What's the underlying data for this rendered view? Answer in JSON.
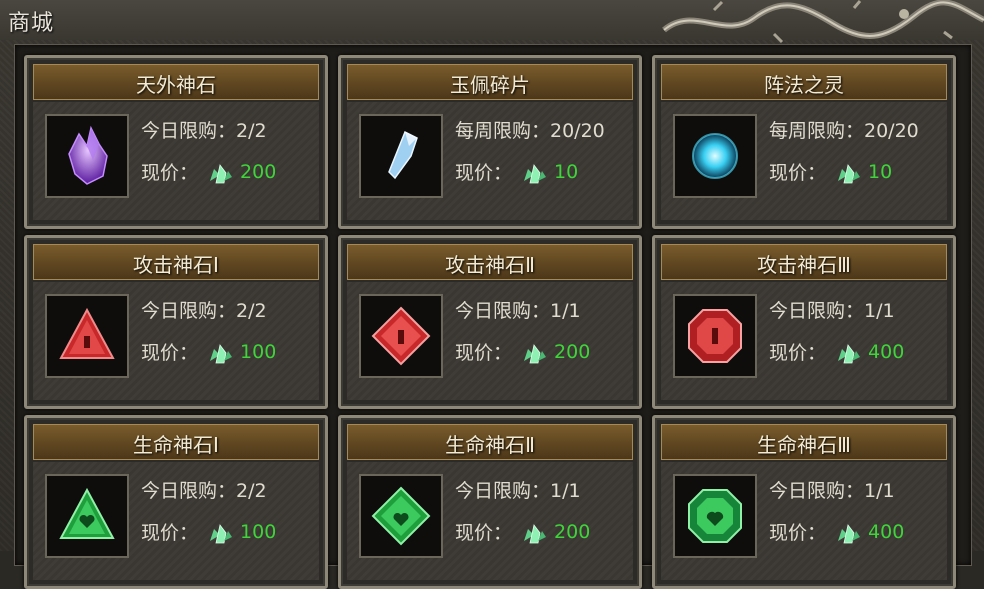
{
  "window": {
    "title": "商城"
  },
  "price_label": "现价：",
  "cards": [
    {
      "name": "天外神石",
      "limit": "今日限购：2/2",
      "price": "200",
      "icon": "purple-crystal-icon"
    },
    {
      "name": "玉佩碎片",
      "limit": "每周限购：20/20",
      "price": "10",
      "icon": "blue-shard-icon"
    },
    {
      "name": "阵法之灵",
      "limit": "每周限购：20/20",
      "price": "10",
      "icon": "cyan-orb-icon"
    },
    {
      "name": "攻击神石Ⅰ",
      "limit": "今日限购：2/2",
      "price": "100",
      "icon": "red-triangle-gem-icon"
    },
    {
      "name": "攻击神石Ⅱ",
      "limit": "今日限购：1/1",
      "price": "200",
      "icon": "red-diamond-gem-icon"
    },
    {
      "name": "攻击神石Ⅲ",
      "limit": "今日限购：1/1",
      "price": "400",
      "icon": "red-octagon-gem-icon"
    },
    {
      "name": "生命神石Ⅰ",
      "limit": "今日限购：2/2",
      "price": "100",
      "icon": "green-triangle-gem-icon"
    },
    {
      "name": "生命神石Ⅱ",
      "limit": "今日限购：1/1",
      "price": "200",
      "icon": "green-diamond-gem-icon"
    },
    {
      "name": "生命神石Ⅲ",
      "limit": "今日限购：1/1",
      "price": "400",
      "icon": "green-octagon-gem-icon"
    }
  ],
  "colors": {
    "price_green": "#3fd43a",
    "header_bronze": "#6b4f24",
    "frame_stone": "#3a3731"
  }
}
